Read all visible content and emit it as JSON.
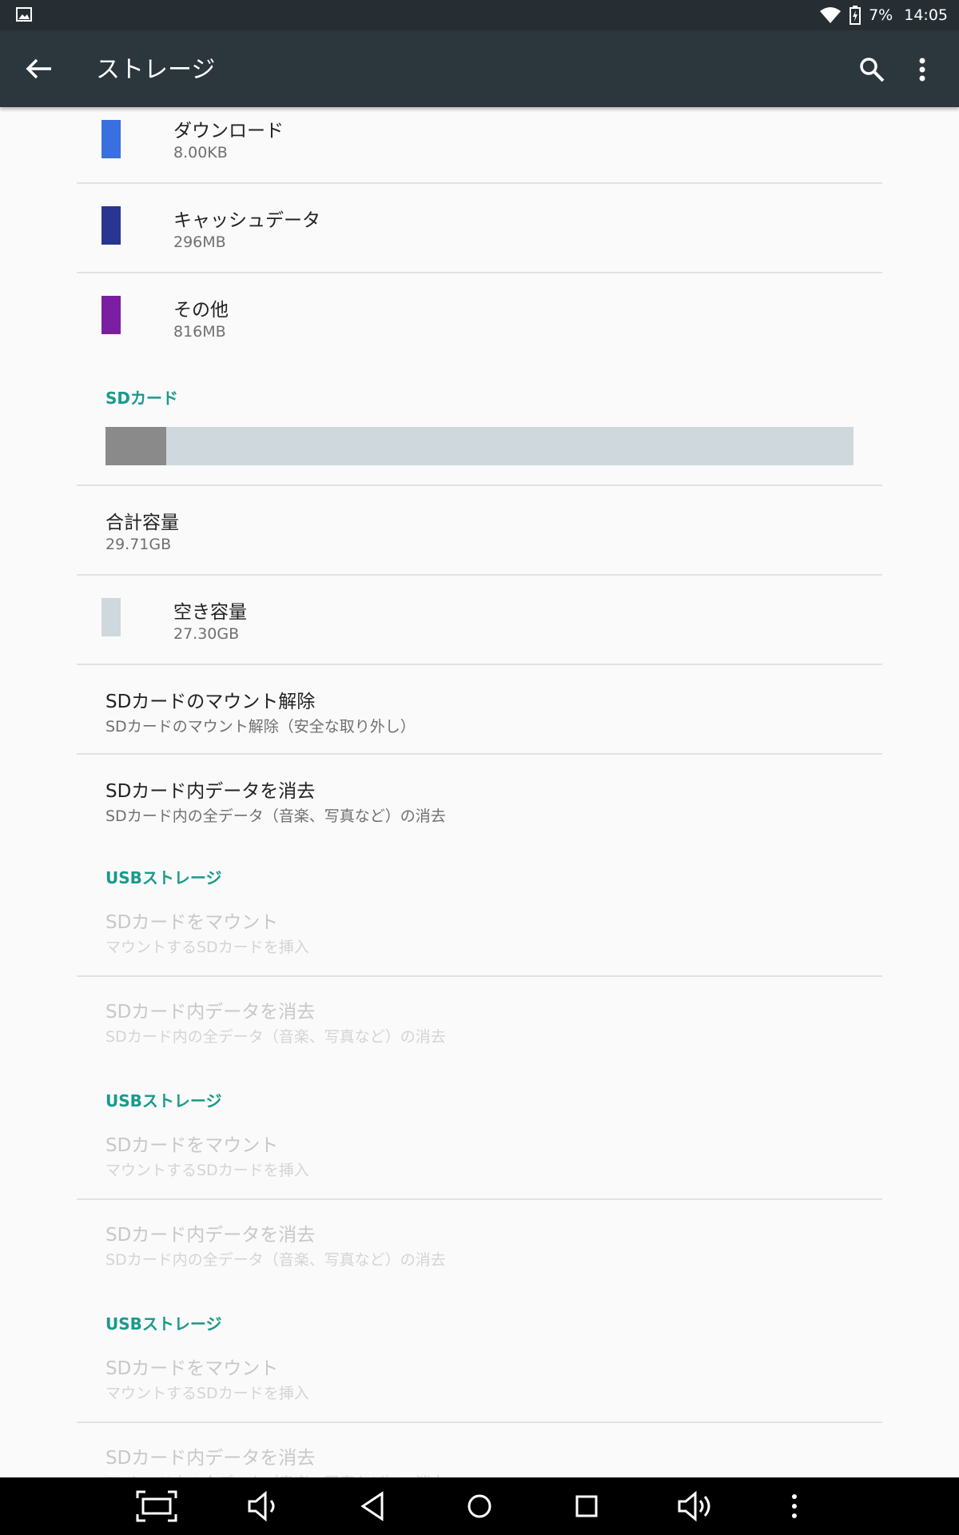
{
  "status_bar": {
    "battery": "7%",
    "time": "14:05"
  },
  "app_bar": {
    "title": "ストレージ"
  },
  "items": {
    "downloads": {
      "title": "ダウンロード",
      "value": "8.00KB",
      "color": "#3a6fe0"
    },
    "cache": {
      "title": "キャッシュデータ",
      "value": "296MB",
      "color": "#283593"
    },
    "other": {
      "title": "その他",
      "value": "816MB",
      "color": "#7b1fa2"
    }
  },
  "sd_card": {
    "header": "SDカード",
    "used_fraction": 0.081,
    "used_color": "#8a8a8a",
    "free_color": "#cfd8dc",
    "total": {
      "title": "合計容量",
      "value": "29.71GB"
    },
    "free": {
      "title": "空き容量",
      "value": "27.30GB"
    },
    "unmount": {
      "title": "SDカードのマウント解除",
      "subtitle": "SDカードのマウント解除（安全な取り外し）"
    },
    "erase": {
      "title": "SDカード内データを消去",
      "subtitle": "SDカード内の全データ（音楽、写真など）の消去"
    }
  },
  "usb_sections": [
    {
      "header": "USBストレージ",
      "mount": {
        "title": "SDカードをマウント",
        "subtitle": "マウントするSDカードを挿入"
      },
      "erase": {
        "title": "SDカード内データを消去",
        "subtitle": "SDカード内の全データ（音楽、写真など）の消去"
      }
    },
    {
      "header": "USBストレージ",
      "mount": {
        "title": "SDカードをマウント",
        "subtitle": "マウントするSDカードを挿入"
      },
      "erase": {
        "title": "SDカード内データを消去",
        "subtitle": "SDカード内の全データ（音楽、写真など）の消去"
      }
    },
    {
      "header": "USBストレージ",
      "mount": {
        "title": "SDカードをマウント",
        "subtitle": "マウントするSDカードを挿入"
      },
      "erase": {
        "title": "SDカード内データを消去",
        "subtitle": "SDカード内の全データ（音楽、写真など）の消去"
      }
    }
  ],
  "accent_color": "#1a9a8c",
  "nav_icons": [
    "screenshot-icon",
    "volume-down-icon",
    "back-triangle-icon",
    "home-circle-icon",
    "recents-square-icon",
    "volume-up-icon",
    "more-vertical-icon"
  ]
}
